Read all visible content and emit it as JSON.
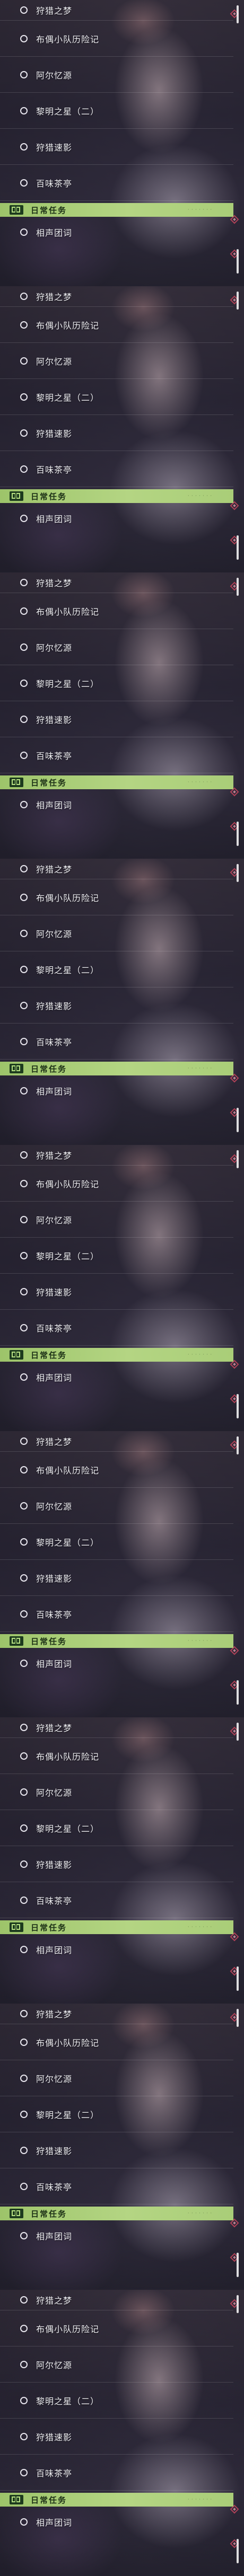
{
  "quests": [
    "狩猎之梦",
    "布偶小队历险记",
    "阿尔忆源",
    "黎明之星（二）",
    "狩猎速影",
    "百味茶亭"
  ],
  "daily": {
    "title": "日常任务",
    "progress": "· · · · · · ·",
    "item": "相声团词"
  },
  "colors": {
    "daily_header": "#b4d583",
    "diamond": "#e0506a"
  },
  "icons": {
    "quest": "circle-outline-icon",
    "daily": "book-icon",
    "tracked": "diamond-icon"
  }
}
